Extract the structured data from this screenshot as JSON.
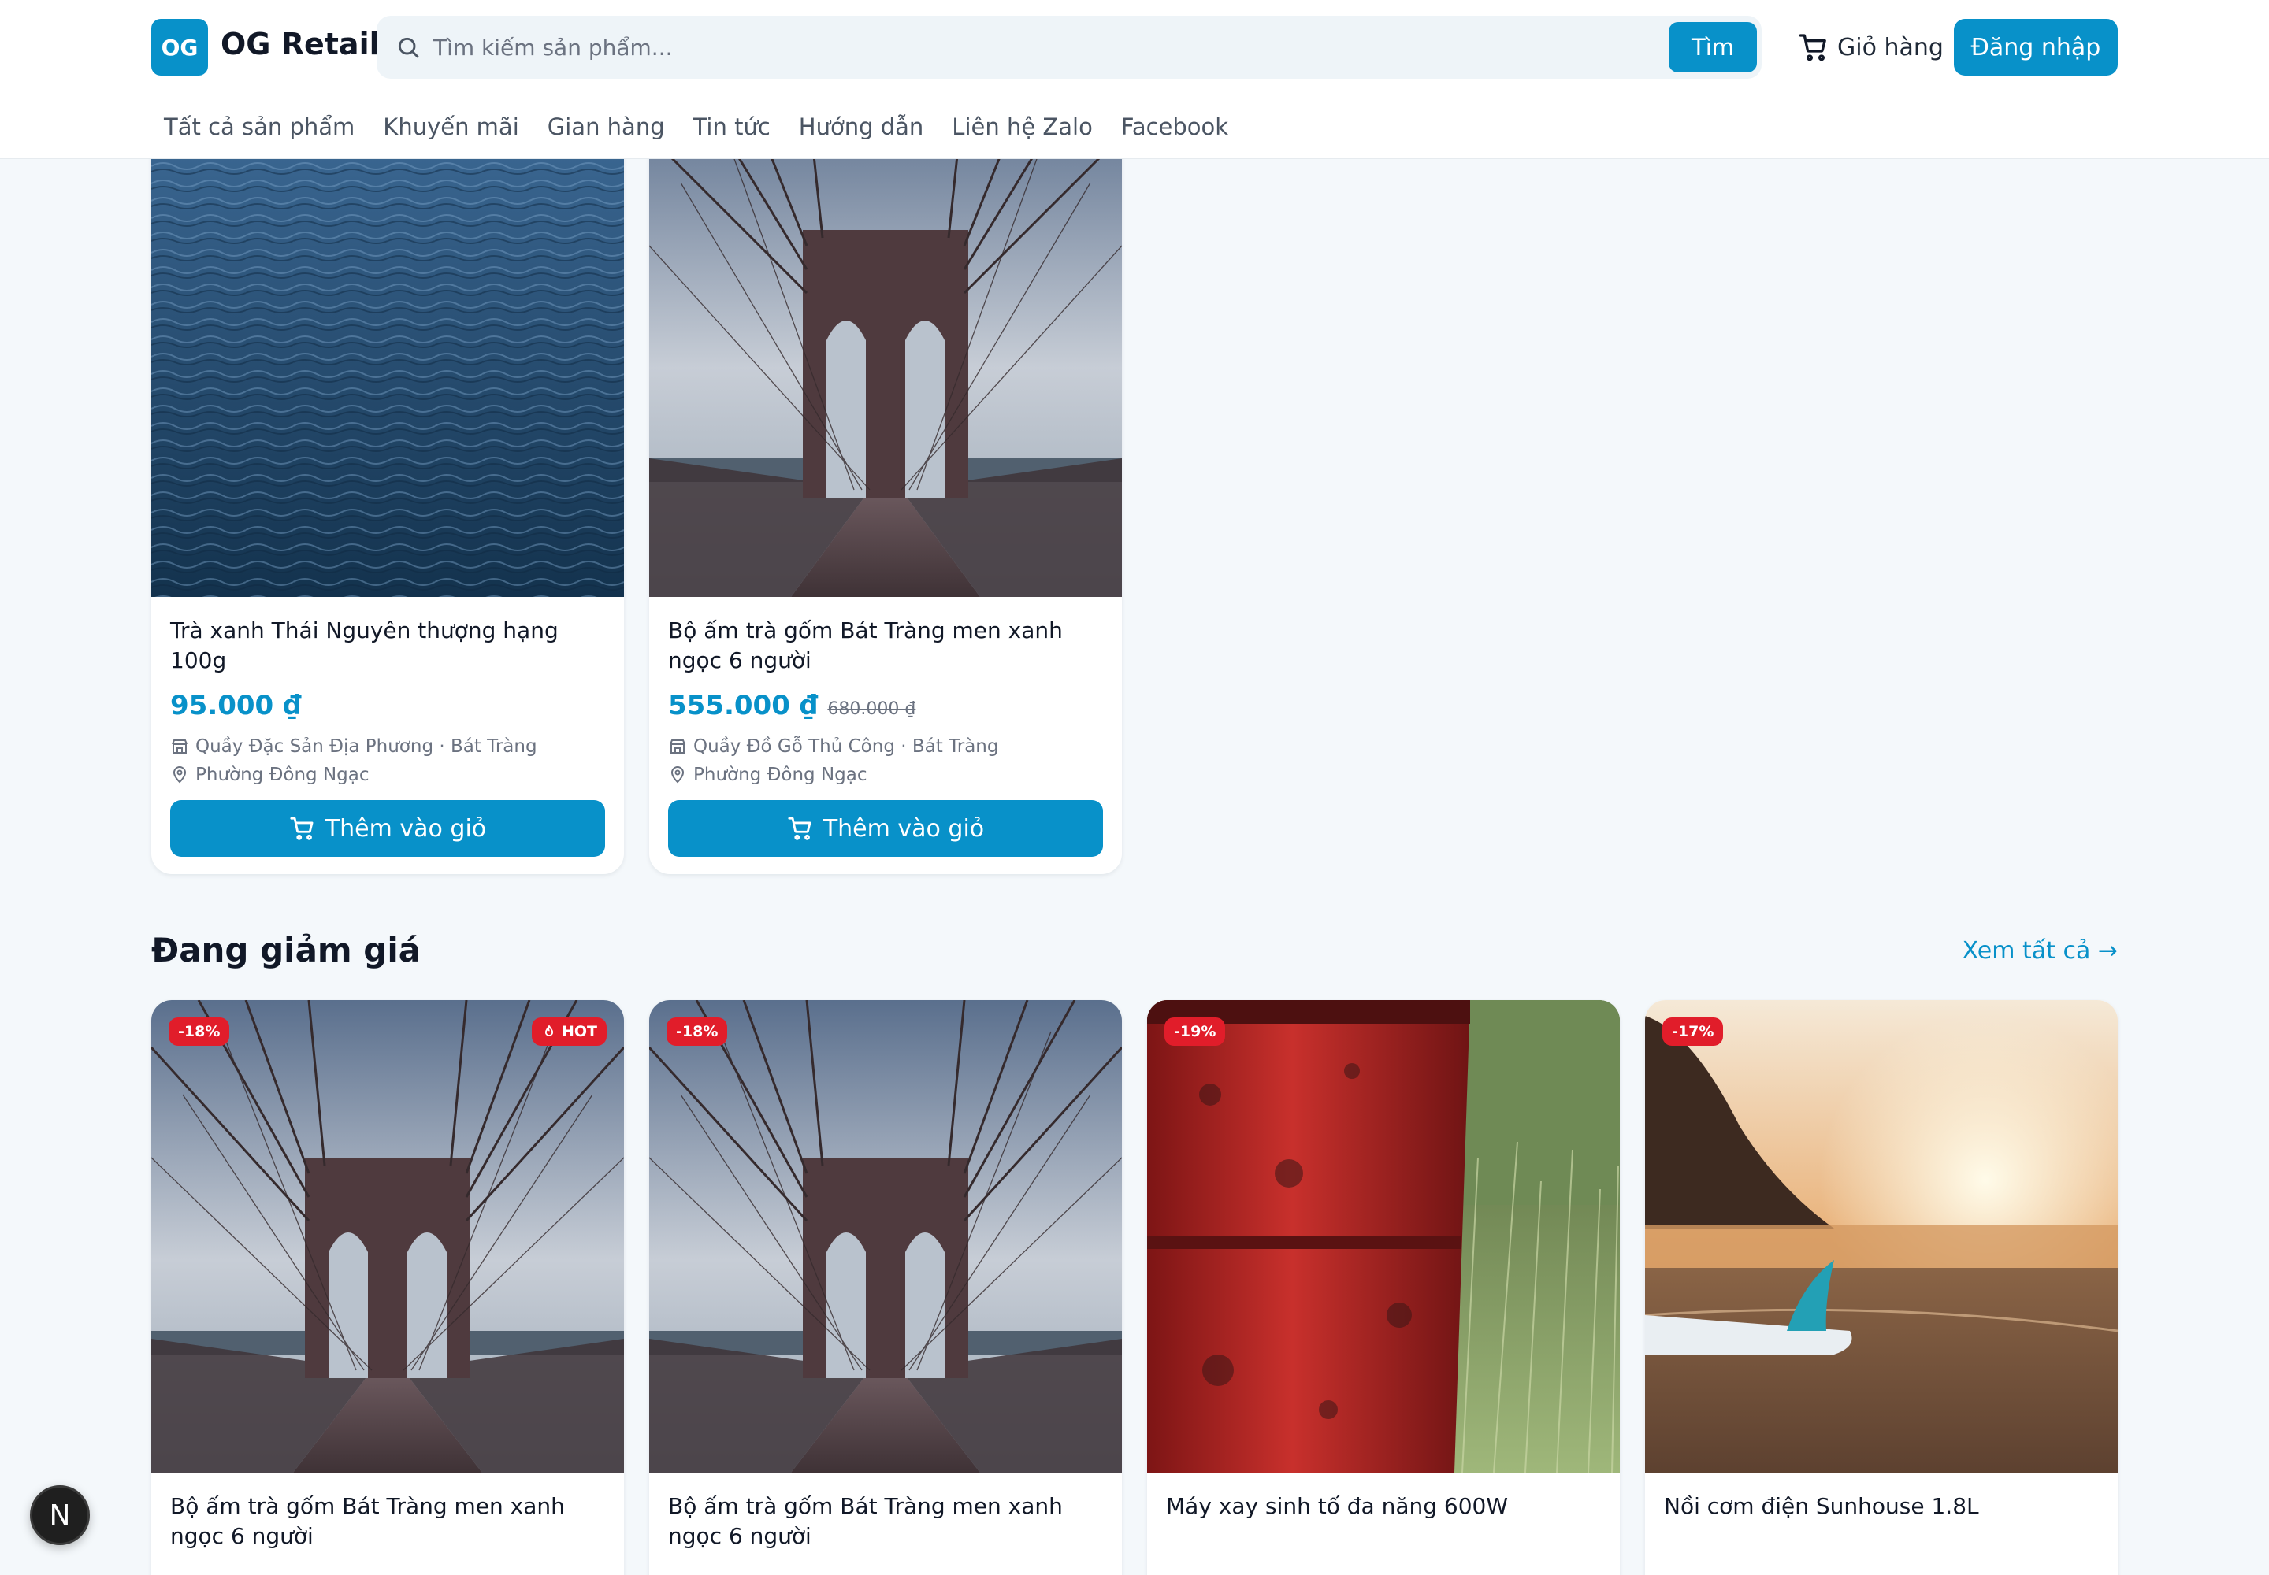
{
  "header": {
    "logo_badge": "OG",
    "brand": "OG Retail",
    "search_placeholder": "Tìm kiếm sản phẩm...",
    "search_button": "Tìm",
    "cart": "Giỏ hàng",
    "login": "Đăng nhập"
  },
  "nav": [
    "Tất cả sản phẩm",
    "Khuyến mãi",
    "Gian hàng",
    "Tin tức",
    "Hướng dẫn",
    "Liên hệ Zalo",
    "Facebook"
  ],
  "top_products": [
    {
      "title": "Trà xanh Thái Nguyên thượng hạng 100g",
      "price": "95.000 ₫",
      "old_price": "",
      "shop": "Quầy Đặc Sản Địa Phương · Bát Tràng",
      "location": "Phường Đông Ngạc",
      "button": "Thêm vào giỏ"
    },
    {
      "title": "Bộ ấm trà gốm Bát Tràng men xanh ngọc 6 người",
      "price": "555.000 ₫",
      "old_price": "680.000 ₫",
      "shop": "Quầy Đồ Gỗ Thủ Công · Bát Tràng",
      "location": "Phường Đông Ngạc",
      "button": "Thêm vào giỏ"
    }
  ],
  "sale_section": {
    "title": "Đang giảm giá",
    "see_all": "Xem tất cả →",
    "products": [
      {
        "discount": "-18%",
        "hot": "HOT",
        "title": "Bộ ấm trà gốm Bát Tràng men xanh ngọc 6 người"
      },
      {
        "discount": "-18%",
        "hot": "",
        "title": "Bộ ấm trà gốm Bát Tràng men xanh ngọc 6 người"
      },
      {
        "discount": "-19%",
        "hot": "",
        "title": "Máy xay sinh tố đa năng 600W"
      },
      {
        "discount": "-17%",
        "hot": "",
        "title": "Nồi cơm điện Sunhouse 1.8L"
      }
    ]
  },
  "colors": {
    "accent": "#0891c9",
    "badge": "#e11d2a",
    "background": "#f4f8fb"
  },
  "icons": [
    "search-icon",
    "cart-icon",
    "store-icon",
    "map-pin-icon",
    "flame-icon",
    "arrow-right-icon"
  ],
  "dev_badge": "N"
}
